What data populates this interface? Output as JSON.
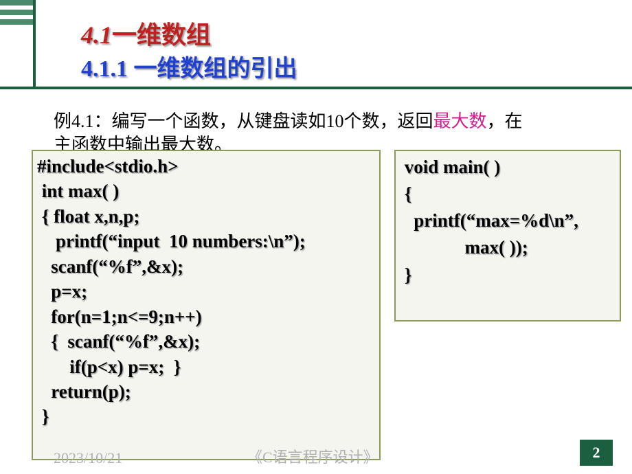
{
  "heading1": {
    "num": "4.1",
    "text": "一维数组"
  },
  "heading2": "4.1.1 一维数组的引出",
  "example": {
    "prefix": "例4.1：编写一个函数，从键盘读如10个数，返回",
    "highlight": "最大数",
    "suffix1": "，在",
    "line2": "主函数中输出最大数。"
  },
  "code_left": {
    "l1": "#include<stdio.h>",
    "l2": " int max( )",
    "l3": " { float x,n,p;",
    "l4": "    printf(“input  10 numbers:\\n”);",
    "l5": "   scanf(“%f”,&x);",
    "l6": "   p=x;",
    "l7": "   for(n=1;n<=9;n++)",
    "l8": "   {  scanf(“%f”,&x);",
    "l9": "       if(p<x) p=x;  }",
    "l10": "   return(p);",
    "l11": " }"
  },
  "code_right": {
    "l1": " void main( )",
    "l2": " {",
    "l3": "   printf(“max=%d\\n”,",
    "l4": "              max( ));",
    "l5": " }"
  },
  "footer": {
    "date": "2023/10/21",
    "title": "《C语言程序设计》",
    "page": "2"
  }
}
